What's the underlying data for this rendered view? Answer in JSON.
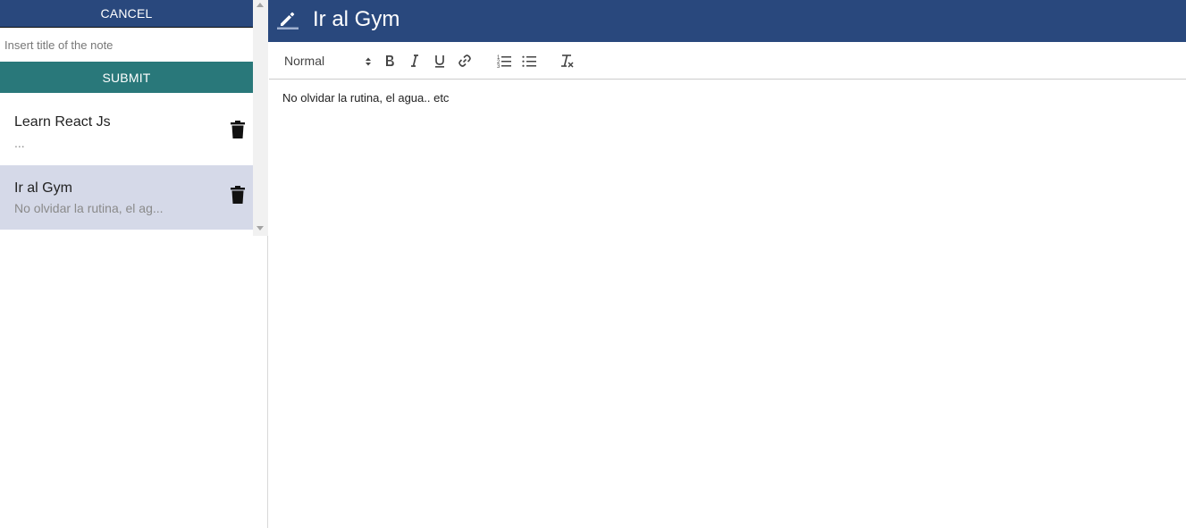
{
  "sidebar": {
    "cancel_label": "CANCEL",
    "title_placeholder": "Insert title of the note",
    "submit_label": "SUBMIT",
    "notes": [
      {
        "title": "Learn React Js",
        "preview": "...",
        "selected": false
      },
      {
        "title": "Ir al Gym",
        "preview": "No olvidar la rutina, el ag...",
        "selected": true
      }
    ]
  },
  "editor": {
    "title": "Ir al Gym",
    "format": "Normal",
    "body": "No olvidar la rutina, el agua.. etc"
  },
  "icons": {
    "edit": "edit-icon",
    "trash": "trash-icon",
    "bold": "bold-icon",
    "italic": "italic-icon",
    "underline": "underline-icon",
    "link": "link-icon",
    "ordered_list": "ordered-list-icon",
    "bullet_list": "bullet-list-icon",
    "clear_format": "clear-format-icon"
  },
  "colors": {
    "primary": "#29487d",
    "submit": "#29787a",
    "selected_note": "#d5d9e8"
  }
}
